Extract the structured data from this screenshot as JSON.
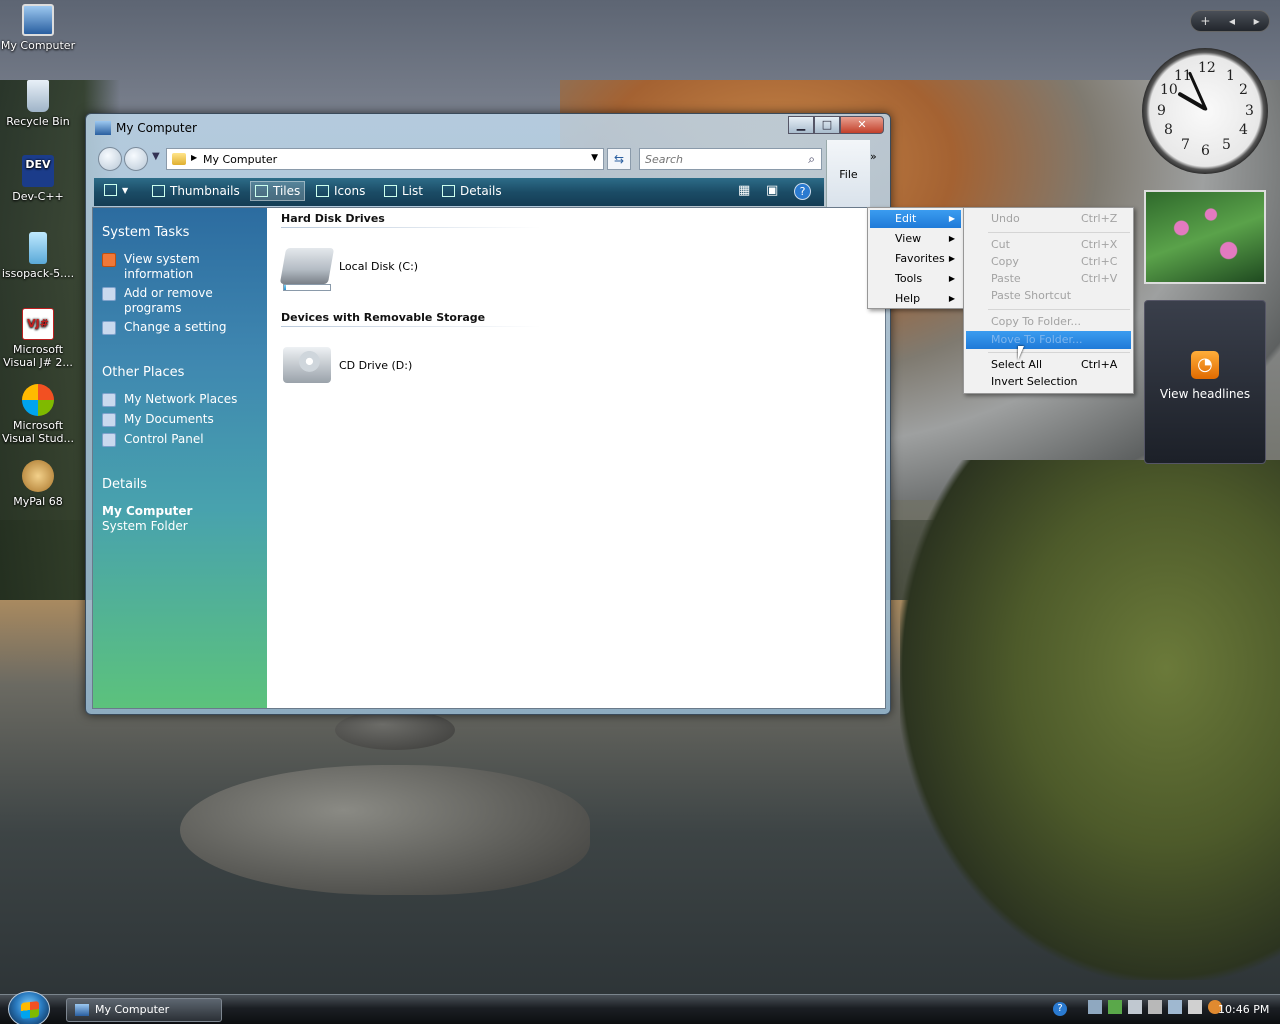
{
  "desktop": {
    "icons": [
      {
        "label": "My Computer",
        "icon": "computer-icon"
      },
      {
        "label": "Recycle Bin",
        "icon": "recycle-bin-icon"
      },
      {
        "label": "Dev-C++",
        "icon": "devcpp-icon",
        "badge": "DEV"
      },
      {
        "label": "issopack-5....",
        "icon": "issopack-icon"
      },
      {
        "label": "Microsoft Visual J# 2...",
        "icon": "visual-jsharp-icon",
        "badge": "VJ#"
      },
      {
        "label": "Microsoft Visual Stud...",
        "icon": "visual-studio-icon"
      },
      {
        "label": "MyPal 68",
        "icon": "mypal-icon"
      }
    ]
  },
  "sidebar_gadgets": {
    "add_symbol": "+",
    "clock_numbers": [
      "12",
      "1",
      "2",
      "3",
      "4",
      "5",
      "6",
      "7",
      "8",
      "9",
      "10",
      "11"
    ],
    "feed_label": "View headlines"
  },
  "window": {
    "title": "My Computer",
    "controls": {
      "minimize": "▁",
      "maximize": "□",
      "close": "✕"
    },
    "address": "My Computer",
    "search_placeholder": "Search",
    "file_menu": "File",
    "chevron": "»",
    "toolbar": {
      "views": [
        {
          "label": "Thumbnails",
          "active": false
        },
        {
          "label": "Tiles",
          "active": true
        },
        {
          "label": "Icons",
          "active": false
        },
        {
          "label": "List",
          "active": false
        },
        {
          "label": "Details",
          "active": false
        }
      ],
      "help": "?"
    },
    "task_pane": {
      "system_tasks": {
        "title": "System Tasks",
        "items": [
          "View system information",
          "Add or remove programs",
          "Change a setting"
        ]
      },
      "other_places": {
        "title": "Other Places",
        "items": [
          "My Network Places",
          "My Documents",
          "Control Panel"
        ]
      },
      "details": {
        "title": "Details",
        "name": "My Computer",
        "type": "System Folder"
      }
    },
    "content": {
      "hard_disk_group": "Hard Disk Drives",
      "local_disk": "Local Disk (C:)",
      "local_disk_used": 0.05,
      "removable_group": "Devices with Removable Storage",
      "cd_drive": "CD Drive (D:)"
    }
  },
  "menu_bar_dropdown": {
    "items": [
      {
        "label": "Edit",
        "selected": true
      },
      {
        "label": "View",
        "selected": false
      },
      {
        "label": "Favorites",
        "selected": false
      },
      {
        "label": "Tools",
        "selected": false
      },
      {
        "label": "Help",
        "selected": false
      }
    ]
  },
  "edit_submenu": {
    "items": [
      {
        "label": "Undo",
        "shortcut": "Ctrl+Z",
        "disabled": true
      },
      {
        "label": "Cut",
        "shortcut": "Ctrl+X",
        "disabled": true
      },
      {
        "label": "Copy",
        "shortcut": "Ctrl+C",
        "disabled": true
      },
      {
        "label": "Paste",
        "shortcut": "Ctrl+V",
        "disabled": true
      },
      {
        "label": "Paste Shortcut",
        "shortcut": "",
        "disabled": true
      },
      {
        "label": "Copy To Folder...",
        "shortcut": "",
        "disabled": true
      },
      {
        "label": "Move To Folder...",
        "shortcut": "",
        "disabled": true,
        "highlighted": true
      },
      {
        "label": "Select All",
        "shortcut": "Ctrl+A",
        "disabled": false
      },
      {
        "label": "Invert Selection",
        "shortcut": "",
        "disabled": false
      }
    ]
  },
  "taskbar": {
    "task_button": "My Computer",
    "time": "10:46 PM",
    "help": "?"
  },
  "colors": {
    "selection": "#1f7ad8",
    "toolbar": "#1b4c66",
    "taskpane": "#3f87b0"
  }
}
